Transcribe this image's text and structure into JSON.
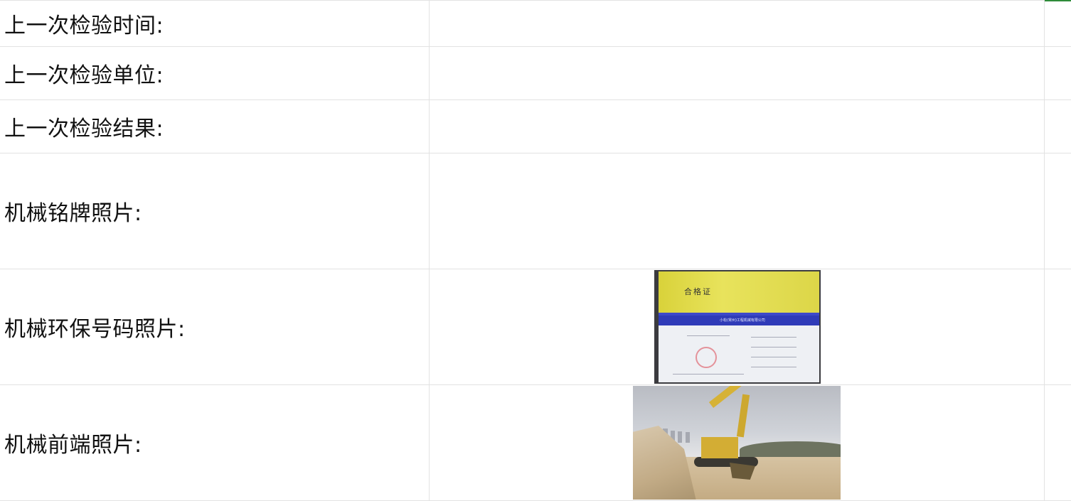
{
  "rows": [
    {
      "label": "上一次检验时间:"
    },
    {
      "label": "上一次检验单位:"
    },
    {
      "label": "上一次检验结果:"
    },
    {
      "label": "机械铭牌照片:"
    },
    {
      "label": "机械环保号码照片:"
    },
    {
      "label": "机械前端照片:"
    }
  ],
  "certificate": {
    "title": "合格证",
    "company": "小松(常州)工程机械有限公司"
  },
  "colors": {
    "grid_line": "#e2e2e2",
    "corner_mark": "#2e8b3a"
  }
}
